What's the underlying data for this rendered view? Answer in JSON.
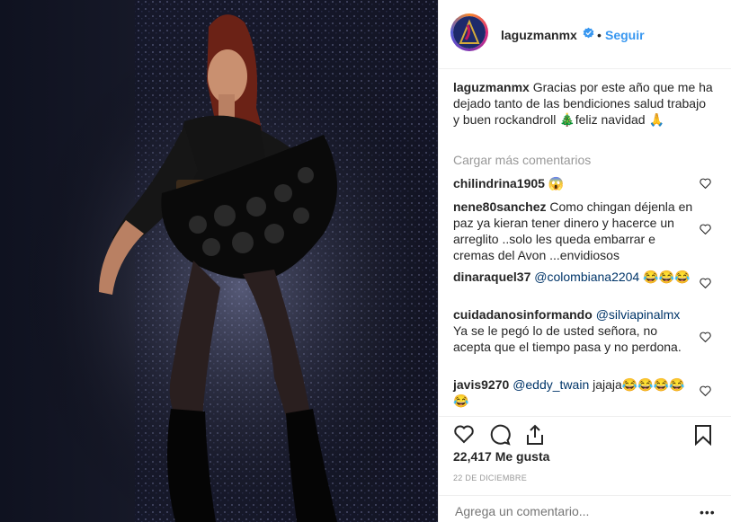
{
  "post": {
    "username": "laguzmanmx",
    "separator": "•",
    "follow_label": "Seguir",
    "caption_user": "laguzmanmx",
    "caption_text": " Gracias por este año que me ha dejado tanto de las bendiciones salud trabajo y buen rockandroll 🎄feliz navidad 🙏",
    "load_more": "Cargar más comentarios",
    "likes": "22,417 Me gusta",
    "date": "22 de diciembre",
    "add_comment_placeholder": "Agrega un comentario...",
    "more_dots": "•••"
  },
  "comments": [
    {
      "user": "chilindrina1905",
      "text": " 😱"
    },
    {
      "user": "nene80sanchez",
      "text": " Como chingan déjenla en paz ya kieran tener dinero y hacerce un arreglito ..solo les queda embarrar e cremas del Avon ...envidiosos"
    },
    {
      "user": "dinaraquel37",
      "mention": "@colombiana2204",
      "text": " 😂😂😂"
    },
    {
      "user": "cuidadanosinformando",
      "mention": "@silviapinalmx",
      "text": " Ya se le pegó lo de usted señora, no acepta que el tiempo pasa y no perdona."
    },
    {
      "user": "javis9270",
      "mention": "@eddy_twain",
      "text": " jajaja😂😂😂😂😂"
    }
  ],
  "icons": {
    "like": "heart-icon",
    "comment": "comment-bubble-icon",
    "share": "share-icon",
    "save": "bookmark-icon",
    "verified": "verified-badge-icon"
  },
  "colors": {
    "link": "#3897f0",
    "mention": "#003569",
    "muted": "#999999",
    "verified": "#3897f0"
  }
}
